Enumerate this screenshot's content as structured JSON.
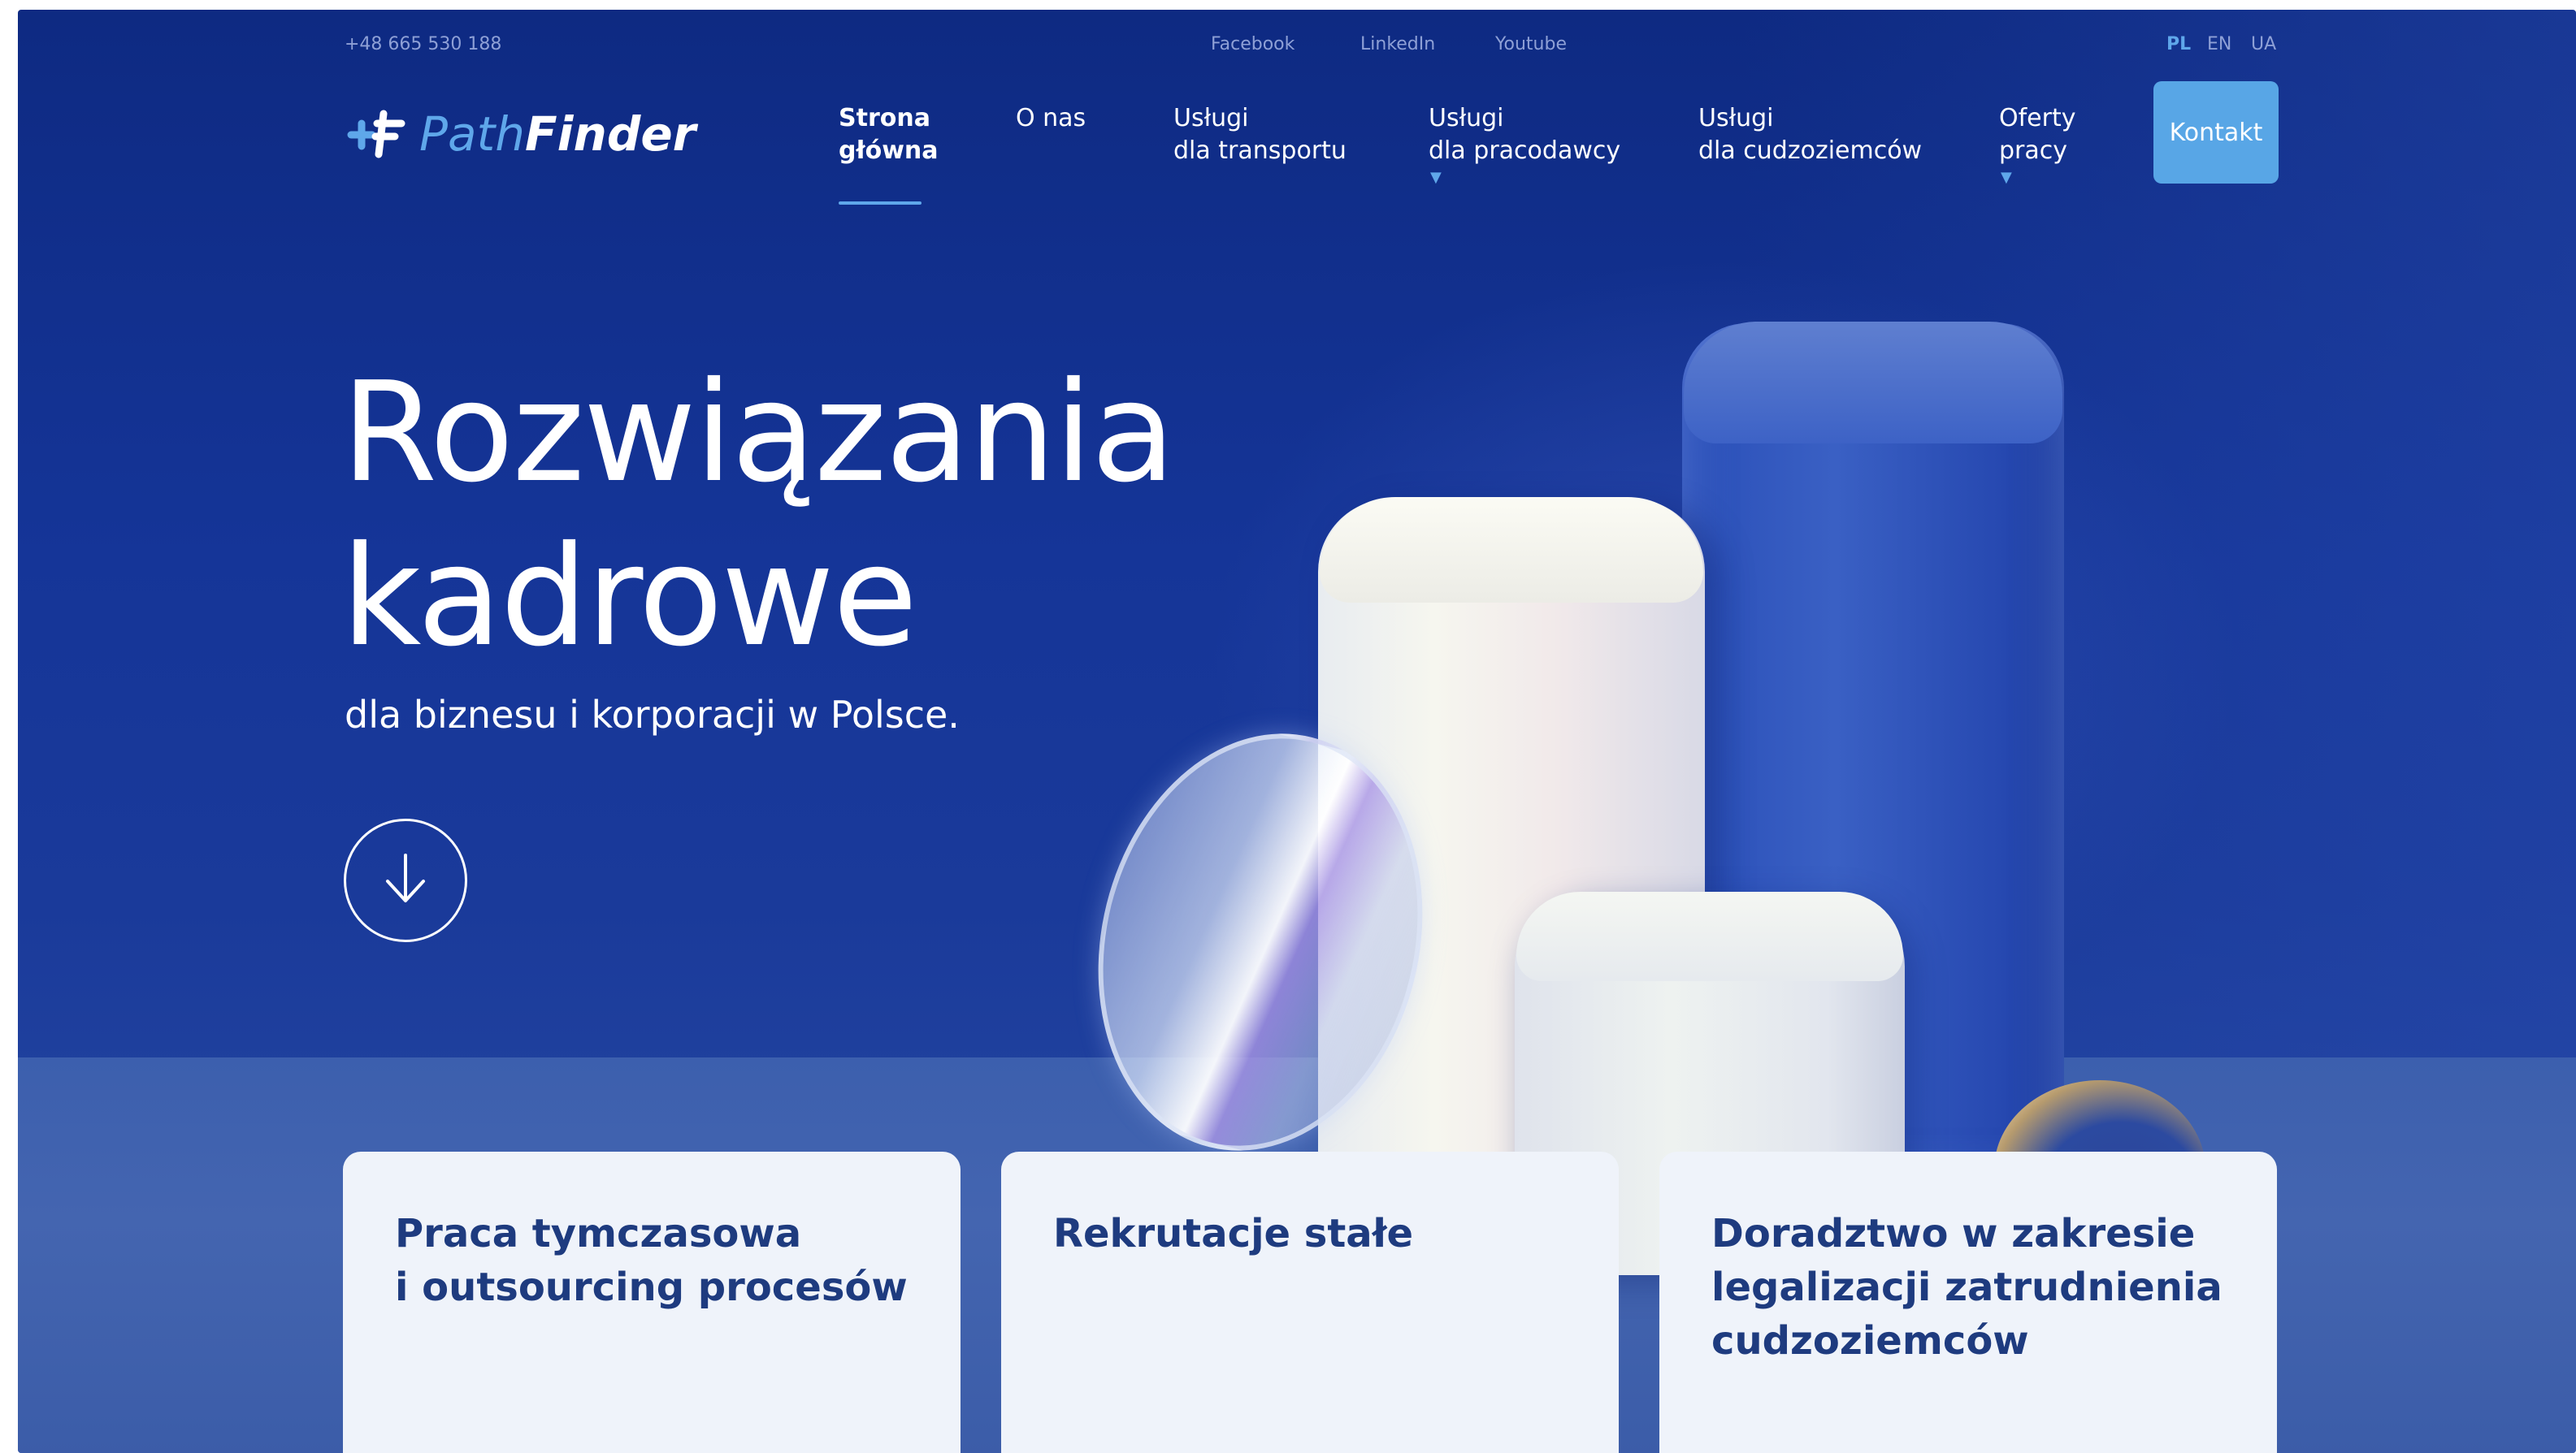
{
  "topbar": {
    "phone": "+48 665 530 188",
    "social": [
      "Facebook",
      "LinkedIn",
      "Youtube"
    ],
    "languages": [
      "PL",
      "EN",
      "UA"
    ],
    "active_language": "PL"
  },
  "header": {
    "logo": {
      "part1": "Path",
      "part2": "Finder"
    },
    "nav": [
      {
        "line1": "Strona",
        "line2": "główna",
        "active": true,
        "has_dropdown": false
      },
      {
        "line1": "O nas",
        "line2": "",
        "active": false,
        "has_dropdown": false
      },
      {
        "line1": "Usługi",
        "line2": "dla transportu",
        "active": false,
        "has_dropdown": false
      },
      {
        "line1": "Usługi",
        "line2": "dla pracodawcy",
        "active": false,
        "has_dropdown": true
      },
      {
        "line1": "Usługi",
        "line2": "dla cudzoziemców",
        "active": false,
        "has_dropdown": false
      },
      {
        "line1": "Oferty",
        "line2": "pracy",
        "active": false,
        "has_dropdown": true
      }
    ],
    "contact_button": "Kontakt",
    "dropdown_icon": "caret-down-icon"
  },
  "hero": {
    "title_line1": "Rozwiązania",
    "title_line2": "kadrowe",
    "subtitle": "dla biznesu i korporacji w Polsce.",
    "scroll_icon": "arrow-down-icon"
  },
  "cards": [
    {
      "line1": "Praca tymczasowa",
      "line2": "i outsourcing procesów",
      "line3": ""
    },
    {
      "line1": "Rekrutacje stałe",
      "line2": "",
      "line3": ""
    },
    {
      "line1": "Doradztwo w zakresie",
      "line2": "legalizacji zatrudnienia",
      "line3": "cudzoziemców"
    }
  ],
  "colors": {
    "accent": "#5fa7ea",
    "background_dark": "#0e2a82",
    "card_bg": "#eff3fa",
    "card_text": "#1e3b7f"
  }
}
